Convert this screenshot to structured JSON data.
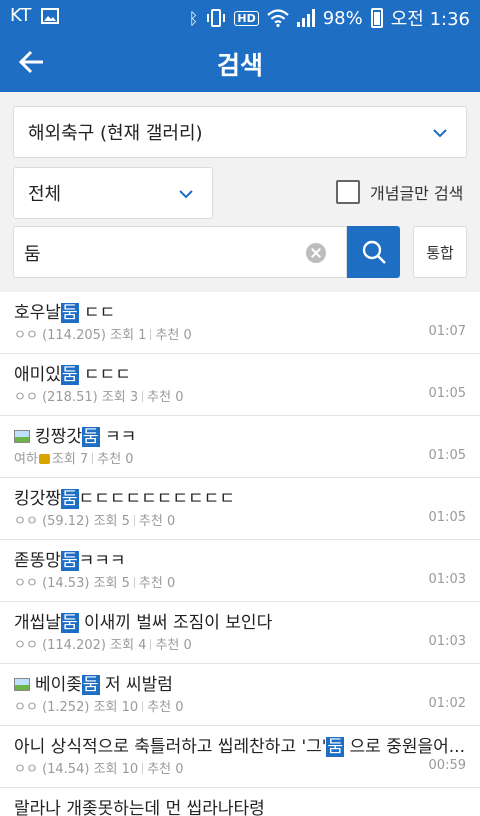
{
  "status": {
    "carrier": "KT",
    "battery": "98%",
    "time": "오전 1:36",
    "icons": [
      "image-icon",
      "bluetooth-icon",
      "vibrate-icon",
      "hd-icon",
      "wifi-icon",
      "signal-icon",
      "battery-icon"
    ]
  },
  "appbar": {
    "title": "검색",
    "back_icon": "back-arrow-icon"
  },
  "filters": {
    "gallery": "해외축구 (현재 갤러리)",
    "scope": "전체",
    "concept_only": "개념글만 검색",
    "concept_checked": false
  },
  "search": {
    "query": "둠",
    "unify_label": "통합"
  },
  "accent": "#1e6fc4",
  "results": [
    {
      "pre": "호우날",
      "hl": "둠",
      "post": " ㄷㄷ",
      "author": "ㅇㅇ",
      "ip": "(114.205)",
      "views": "조회 1",
      "likes": "추천 0",
      "time": "01:07"
    },
    {
      "pre": "애미있",
      "hl": "둠",
      "post": " ㄷㄷㄷ",
      "author": "ㅇㅇ",
      "ip": "(218.51)",
      "views": "조회 3",
      "likes": "추천 0",
      "time": "01:05"
    },
    {
      "pre": "킹짱갓",
      "hl": "둠",
      "post": " ㅋㅋ",
      "author": "여하",
      "ip": "",
      "views": "조회 7",
      "likes": "추천 0",
      "time": "01:05"
    },
    {
      "pre": "킹갓짱",
      "hl": "둠",
      "post": "ㄷㄷㄷㄷㄷㄷㄷㄷㄷㄷ",
      "author": "ㅇㅇ",
      "ip": "(59.12)",
      "views": "조회 5",
      "likes": "추천 0",
      "time": "01:05"
    },
    {
      "pre": "졷똥망",
      "hl": "둠",
      "post": "ㅋㅋㅋ",
      "author": "ㅇㅇ",
      "ip": "(14.53)",
      "views": "조회 5",
      "likes": "추천 0",
      "time": "01:03"
    },
    {
      "pre": "개씹날",
      "hl": "둠",
      "post": " 이새끼 벌써 조짐이 보인다",
      "author": "ㅇㅇ",
      "ip": "(114.202)",
      "views": "조회 4",
      "likes": "추천 0",
      "time": "01:03"
    },
    {
      "pre": "베이좆",
      "hl": "둠",
      "post": " 저 씨발럼",
      "author": "ㅇㅇ",
      "ip": "(1.252)",
      "views": "조회 10",
      "likes": "추천 0",
      "time": "01:02"
    },
    {
      "pre": "아니 상식적으로 축틀러하고 씹레찬하고 '그'",
      "hl": "둠",
      "post": " 으로 중원을어...",
      "author": "ㅇㅇ",
      "ip": "(14.54)",
      "views": "조회 10",
      "likes": "추천 0",
      "time": "00:59"
    },
    {
      "pre": "랄라나 개좆못하는데 먼 씹라나타령",
      "hl": "",
      "post": "",
      "author": "",
      "ip": "",
      "views": "",
      "likes": "",
      "time": ""
    }
  ]
}
